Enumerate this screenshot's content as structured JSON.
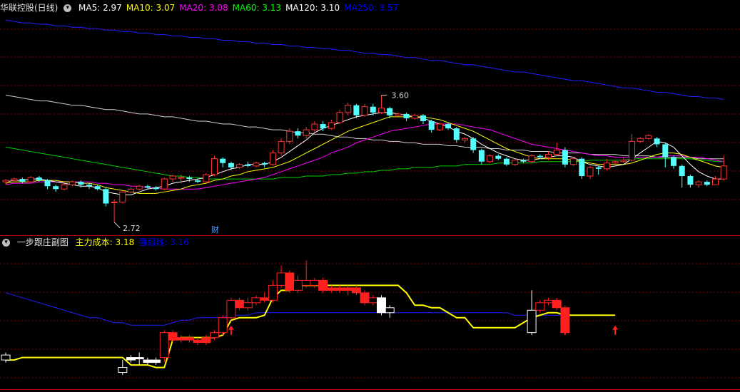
{
  "main_panel": {
    "title": "华联控股(日线)",
    "indicators": [
      {
        "label": "MA5: 2.97",
        "color": "#ffffff"
      },
      {
        "label": "MA10: 3.07",
        "color": "#ffff00"
      },
      {
        "label": "MA20: 3.08",
        "color": "#ff00ff"
      },
      {
        "label": "MA60: 3.13",
        "color": "#00ff00"
      },
      {
        "label": "MA120: 3.10",
        "color": "#ffffff"
      },
      {
        "label": "MA250: 3.57",
        "color": "#0000ff"
      }
    ],
    "high_label": "3.60",
    "low_label": "2.72",
    "marker": "财"
  },
  "sub_panel": {
    "title": "一步跟庄副图",
    "indicators": [
      {
        "label": "主力成本: 3.18",
        "color": "#ffff00"
      },
      {
        "label": "强弱线: 3.16",
        "color": "#0000ff"
      }
    ]
  },
  "colors": {
    "up": "#ff3232",
    "down": "#54ffff",
    "grid": "#8a0000",
    "ma5": "#ffffff",
    "ma10": "#ffff00",
    "ma20": "#ff00ff",
    "ma60": "#00d000",
    "ma120": "#cfcfcf",
    "ma250": "#2020ff",
    "cost": "#ffff00",
    "strength": "#2020ff"
  },
  "candles": [
    [
      3.0,
      3.01,
      2.98,
      3.02
    ],
    [
      3.01,
      3.02,
      3.0,
      3.03
    ],
    [
      3.02,
      3.0,
      2.99,
      3.03
    ],
    [
      3.0,
      3.03,
      2.99,
      3.04
    ],
    [
      3.03,
      3.01,
      3.0,
      3.04
    ],
    [
      3.01,
      2.97,
      2.95,
      3.02
    ],
    [
      2.97,
      2.95,
      2.93,
      2.98
    ],
    [
      2.95,
      2.98,
      2.94,
      2.99
    ],
    [
      2.98,
      3.0,
      2.97,
      3.01
    ],
    [
      3.0,
      2.98,
      2.96,
      3.01
    ],
    [
      2.98,
      2.97,
      2.95,
      2.99
    ],
    [
      2.97,
      2.95,
      2.94,
      2.98
    ],
    [
      2.95,
      2.85,
      2.83,
      2.96
    ],
    [
      2.86,
      2.86,
      2.72,
      2.88
    ],
    [
      2.86,
      2.93,
      2.85,
      2.94
    ],
    [
      2.93,
      2.95,
      2.92,
      2.96
    ],
    [
      2.95,
      2.97,
      2.94,
      2.98
    ],
    [
      2.97,
      2.96,
      2.95,
      2.98
    ],
    [
      2.96,
      2.95,
      2.94,
      2.97
    ],
    [
      2.95,
      3.02,
      2.94,
      3.03
    ],
    [
      3.02,
      3.04,
      3.0,
      3.05
    ],
    [
      3.03,
      3.03,
      2.99,
      3.05
    ],
    [
      3.03,
      3.02,
      3.0,
      3.04
    ],
    [
      3.01,
      3.0,
      2.99,
      3.02
    ],
    [
      3.0,
      3.05,
      2.99,
      3.06
    ],
    [
      3.05,
      3.16,
      3.04,
      3.18
    ],
    [
      3.16,
      3.13,
      3.1,
      3.17
    ],
    [
      3.13,
      3.1,
      3.08,
      3.14
    ],
    [
      3.1,
      3.12,
      3.09,
      3.13
    ],
    [
      3.12,
      3.11,
      3.1,
      3.14
    ],
    [
      3.11,
      3.13,
      3.1,
      3.14
    ],
    [
      3.13,
      3.12,
      3.1,
      3.14
    ],
    [
      3.12,
      3.2,
      3.11,
      3.22
    ],
    [
      3.2,
      3.28,
      3.18,
      3.3
    ],
    [
      3.28,
      3.35,
      3.26,
      3.37
    ],
    [
      3.35,
      3.32,
      3.3,
      3.37
    ],
    [
      3.32,
      3.36,
      3.3,
      3.38
    ],
    [
      3.36,
      3.4,
      3.34,
      3.42
    ],
    [
      3.4,
      3.37,
      3.35,
      3.42
    ],
    [
      3.37,
      3.41,
      3.36,
      3.43
    ],
    [
      3.41,
      3.48,
      3.4,
      3.5
    ],
    [
      3.48,
      3.53,
      3.46,
      3.55
    ],
    [
      3.53,
      3.46,
      3.44,
      3.54
    ],
    [
      3.46,
      3.52,
      3.45,
      3.54
    ],
    [
      3.52,
      3.48,
      3.46,
      3.54
    ],
    [
      3.48,
      3.51,
      3.47,
      3.6
    ],
    [
      3.51,
      3.46,
      3.44,
      3.52
    ],
    [
      3.46,
      3.47,
      3.45,
      3.48
    ],
    [
      3.47,
      3.44,
      3.42,
      3.48
    ],
    [
      3.44,
      3.46,
      3.43,
      3.47
    ],
    [
      3.46,
      3.42,
      3.4,
      3.47
    ],
    [
      3.42,
      3.36,
      3.34,
      3.43
    ],
    [
      3.36,
      3.4,
      3.35,
      3.41
    ],
    [
      3.4,
      3.37,
      3.36,
      3.41
    ],
    [
      3.37,
      3.29,
      3.27,
      3.38
    ],
    [
      3.29,
      3.3,
      3.27,
      3.31
    ],
    [
      3.3,
      3.22,
      3.2,
      3.31
    ],
    [
      3.22,
      3.14,
      3.12,
      3.23
    ],
    [
      3.14,
      3.18,
      3.13,
      3.19
    ],
    [
      3.18,
      3.16,
      3.15,
      3.19
    ],
    [
      3.16,
      3.12,
      3.11,
      3.17
    ],
    [
      3.12,
      3.15,
      3.11,
      3.16
    ],
    [
      3.15,
      3.14,
      3.13,
      3.16
    ],
    [
      3.14,
      3.18,
      3.13,
      3.19
    ],
    [
      3.18,
      3.17,
      3.16,
      3.19
    ],
    [
      3.17,
      3.19,
      3.15,
      3.21
    ],
    [
      3.19,
      3.22,
      3.18,
      3.27
    ],
    [
      3.22,
      3.12,
      3.1,
      3.24
    ],
    [
      3.12,
      3.16,
      3.11,
      3.17
    ],
    [
      3.16,
      3.04,
      3.02,
      3.17
    ],
    [
      3.04,
      3.1,
      3.02,
      3.11
    ],
    [
      3.1,
      3.09,
      3.05,
      3.11
    ],
    [
      3.09,
      3.13,
      3.08,
      3.16
    ],
    [
      3.13,
      3.14,
      3.12,
      3.15
    ],
    [
      3.14,
      3.15,
      3.13,
      3.17
    ],
    [
      3.15,
      3.28,
      3.14,
      3.33
    ],
    [
      3.28,
      3.3,
      3.27,
      3.31
    ],
    [
      3.3,
      3.32,
      3.29,
      3.33
    ],
    [
      3.3,
      3.26,
      3.24,
      3.31
    ],
    [
      3.26,
      3.17,
      3.1,
      3.27
    ],
    [
      3.17,
      3.11,
      3.09,
      3.18
    ],
    [
      3.11,
      3.04,
      2.96,
      3.12
    ],
    [
      3.04,
      2.98,
      2.96,
      3.05
    ],
    [
      2.98,
      3.0,
      2.96,
      3.01
    ],
    [
      3.0,
      2.98,
      2.97,
      3.01
    ],
    [
      2.98,
      3.02,
      2.98,
      3.04
    ],
    [
      3.02,
      3.11,
      3.01,
      3.18
    ]
  ],
  "ma_lines": {
    "ma5": [
      3.0,
      3.01,
      3.01,
      3.02,
      3.02,
      3.01,
      3.0,
      2.99,
      2.98,
      2.97,
      2.97,
      2.96,
      2.93,
      2.92,
      2.91,
      2.91,
      2.93,
      2.95,
      2.96,
      2.97,
      2.99,
      3.0,
      3.01,
      3.02,
      3.03,
      3.05,
      3.07,
      3.09,
      3.1,
      3.12,
      3.12,
      3.12,
      3.14,
      3.17,
      3.21,
      3.25,
      3.29,
      3.34,
      3.37,
      3.39,
      3.41,
      3.43,
      3.45,
      3.46,
      3.47,
      3.48,
      3.48,
      3.47,
      3.46,
      3.45,
      3.44,
      3.42,
      3.4,
      3.38,
      3.35,
      3.33,
      3.3,
      3.26,
      3.23,
      3.2,
      3.18,
      3.16,
      3.15,
      3.15,
      3.16,
      3.17,
      3.18,
      3.18,
      3.17,
      3.14,
      3.12,
      3.11,
      3.1,
      3.11,
      3.12,
      3.16,
      3.2,
      3.24,
      3.28,
      3.27,
      3.24,
      3.18,
      3.12,
      3.07,
      3.04,
      3.02,
      3.02
    ],
    "ma10": [
      2.99,
      3.0,
      3.0,
      3.0,
      3.01,
      3.01,
      3.01,
      3.0,
      3.0,
      2.99,
      2.99,
      2.98,
      2.96,
      2.95,
      2.94,
      2.93,
      2.92,
      2.92,
      2.92,
      2.93,
      2.94,
      2.95,
      2.97,
      2.98,
      2.99,
      3.01,
      3.02,
      3.04,
      3.05,
      3.07,
      3.08,
      3.09,
      3.1,
      3.12,
      3.14,
      3.17,
      3.2,
      3.23,
      3.26,
      3.29,
      3.32,
      3.35,
      3.37,
      3.39,
      3.41,
      3.43,
      3.45,
      3.45,
      3.45,
      3.45,
      3.45,
      3.44,
      3.43,
      3.41,
      3.39,
      3.37,
      3.35,
      3.32,
      3.29,
      3.26,
      3.23,
      3.21,
      3.19,
      3.17,
      3.16,
      3.16,
      3.16,
      3.16,
      3.15,
      3.14,
      3.13,
      3.12,
      3.12,
      3.12,
      3.12,
      3.13,
      3.15,
      3.17,
      3.19,
      3.2,
      3.2,
      3.19,
      3.17,
      3.15,
      3.13,
      3.11,
      3.1
    ],
    "ma20": [
      2.98,
      2.99,
      2.99,
      2.99,
      3.0,
      3.0,
      3.0,
      3.0,
      3.0,
      3.0,
      3.0,
      2.99,
      2.99,
      2.98,
      2.98,
      2.97,
      2.97,
      2.96,
      2.96,
      2.95,
      2.95,
      2.95,
      2.95,
      2.95,
      2.96,
      2.97,
      2.98,
      2.99,
      3.0,
      3.01,
      3.02,
      3.03,
      3.05,
      3.07,
      3.09,
      3.11,
      3.13,
      3.15,
      3.17,
      3.2,
      3.22,
      3.24,
      3.27,
      3.29,
      3.31,
      3.33,
      3.35,
      3.36,
      3.37,
      3.38,
      3.39,
      3.4,
      3.4,
      3.4,
      3.4,
      3.39,
      3.38,
      3.37,
      3.36,
      3.34,
      3.32,
      3.3,
      3.28,
      3.26,
      3.25,
      3.24,
      3.23,
      3.22,
      3.21,
      3.2,
      3.19,
      3.18,
      3.18,
      3.17,
      3.17,
      3.17,
      3.17,
      3.17,
      3.17,
      3.18,
      3.18,
      3.18,
      3.17,
      3.17,
      3.16,
      3.15,
      3.14
    ],
    "ma60": [
      3.24,
      3.23,
      3.22,
      3.21,
      3.2,
      3.19,
      3.18,
      3.17,
      3.16,
      3.15,
      3.14,
      3.13,
      3.12,
      3.11,
      3.1,
      3.09,
      3.08,
      3.07,
      3.06,
      3.05,
      3.04,
      3.04,
      3.03,
      3.03,
      3.02,
      3.02,
      3.02,
      3.02,
      3.02,
      3.02,
      3.02,
      3.02,
      3.02,
      3.03,
      3.03,
      3.03,
      3.04,
      3.04,
      3.04,
      3.05,
      3.05,
      3.06,
      3.06,
      3.07,
      3.07,
      3.08,
      3.08,
      3.09,
      3.09,
      3.1,
      3.1,
      3.1,
      3.11,
      3.11,
      3.11,
      3.12,
      3.12,
      3.12,
      3.12,
      3.13,
      3.13,
      3.13,
      3.13,
      3.13,
      3.14,
      3.14,
      3.14,
      3.14,
      3.14,
      3.14,
      3.15,
      3.15,
      3.15,
      3.15,
      3.15,
      3.16,
      3.16,
      3.16,
      3.16,
      3.16,
      3.16,
      3.16,
      3.16,
      3.15,
      3.15,
      3.14,
      3.14
    ],
    "ma120": [
      3.6,
      3.59,
      3.58,
      3.57,
      3.56,
      3.56,
      3.55,
      3.54,
      3.53,
      3.53,
      3.52,
      3.51,
      3.5,
      3.5,
      3.49,
      3.48,
      3.47,
      3.47,
      3.46,
      3.45,
      3.45,
      3.44,
      3.43,
      3.42,
      3.42,
      3.41,
      3.4,
      3.4,
      3.39,
      3.38,
      3.38,
      3.37,
      3.36,
      3.36,
      3.35,
      3.34,
      3.34,
      3.33,
      3.33,
      3.32,
      3.31,
      3.31,
      3.3,
      3.3,
      3.29,
      3.29,
      3.28,
      3.28,
      3.27,
      3.27,
      3.26,
      3.26,
      3.26,
      3.25,
      3.25,
      3.24,
      3.24,
      3.24,
      3.23,
      3.23,
      3.22,
      3.22,
      3.22,
      3.21,
      3.21,
      3.21,
      3.2,
      3.2,
      3.2,
      3.2,
      3.19,
      3.19,
      3.19,
      3.19,
      3.18,
      3.18,
      3.18,
      3.18,
      3.17,
      3.17,
      3.17,
      3.17,
      3.17,
      3.16,
      3.16,
      3.16,
      3.16
    ],
    "ma250": [
      4.12,
      4.11,
      4.1,
      4.1,
      4.09,
      4.09,
      4.08,
      4.08,
      4.07,
      4.07,
      4.06,
      4.06,
      4.05,
      4.05,
      4.04,
      4.04,
      4.03,
      4.03,
      4.02,
      4.02,
      4.01,
      4.01,
      4.0,
      4.0,
      3.99,
      3.99,
      3.98,
      3.98,
      3.97,
      3.97,
      3.96,
      3.96,
      3.95,
      3.95,
      3.94,
      3.94,
      3.93,
      3.93,
      3.92,
      3.92,
      3.91,
      3.91,
      3.9,
      3.89,
      3.89,
      3.88,
      3.88,
      3.87,
      3.86,
      3.86,
      3.85,
      3.84,
      3.84,
      3.83,
      3.82,
      3.81,
      3.81,
      3.8,
      3.79,
      3.78,
      3.77,
      3.76,
      3.76,
      3.75,
      3.74,
      3.73,
      3.72,
      3.71,
      3.7,
      3.7,
      3.69,
      3.68,
      3.67,
      3.66,
      3.65,
      3.65,
      3.64,
      3.63,
      3.62,
      3.62,
      3.61,
      3.6,
      3.59,
      3.59,
      3.58,
      3.58,
      3.57
    ]
  },
  "sub_candles": [
    [
      0,
      2.95,
      2.97,
      2.94,
      2.98,
      "hollow"
    ],
    [
      14,
      2.92,
      2.9,
      2.89,
      2.95,
      "hollow"
    ],
    [
      15,
      2.95,
      2.96,
      2.94,
      2.97,
      "white"
    ],
    [
      16,
      2.96,
      2.96,
      2.93,
      2.98,
      "white"
    ],
    [
      17,
      2.95,
      2.94,
      2.93,
      2.96,
      "white"
    ],
    [
      18,
      2.94,
      2.95,
      2.93,
      2.96,
      "white"
    ],
    [
      19,
      2.96,
      3.06,
      2.94,
      3.07,
      "hollow-red"
    ],
    [
      20,
      3.06,
      3.03,
      3.02,
      3.07,
      "red"
    ],
    [
      21,
      3.03,
      3.04,
      3.02,
      3.05,
      "red"
    ],
    [
      22,
      3.04,
      3.03,
      3.02,
      3.05,
      "red"
    ],
    [
      23,
      3.03,
      3.02,
      3.01,
      3.04,
      "red"
    ],
    [
      24,
      3.02,
      3.04,
      3.01,
      3.05,
      "red"
    ],
    [
      25,
      3.04,
      3.06,
      3.03,
      3.07,
      "hollow-red"
    ],
    [
      26,
      3.06,
      3.12,
      3.05,
      3.13,
      "hollow-red"
    ],
    [
      27,
      3.12,
      3.19,
      3.11,
      3.2,
      "hollow-red"
    ],
    [
      28,
      3.19,
      3.16,
      3.15,
      3.2,
      "red"
    ],
    [
      29,
      3.16,
      3.18,
      3.15,
      3.2,
      "hollow-red"
    ],
    [
      30,
      3.18,
      3.2,
      3.17,
      3.21,
      "hollow-red"
    ],
    [
      31,
      3.2,
      3.19,
      3.18,
      3.22,
      "red"
    ],
    [
      32,
      3.19,
      3.25,
      3.18,
      3.27,
      "hollow-red"
    ],
    [
      33,
      3.25,
      3.3,
      3.24,
      3.33,
      "hollow-red"
    ],
    [
      34,
      3.3,
      3.23,
      3.22,
      3.31,
      "red"
    ],
    [
      35,
      3.23,
      3.27,
      3.22,
      3.29,
      "hollow-red"
    ],
    [
      36,
      3.27,
      3.25,
      3.24,
      3.35,
      "hollow-red"
    ],
    [
      37,
      3.25,
      3.27,
      3.24,
      3.28,
      "hollow-red"
    ],
    [
      38,
      3.27,
      3.23,
      3.22,
      3.28,
      "red"
    ],
    [
      39,
      3.23,
      3.24,
      3.22,
      3.25,
      "red"
    ],
    [
      40,
      3.24,
      3.23,
      3.22,
      3.25,
      "red"
    ],
    [
      41,
      3.23,
      3.24,
      3.21,
      3.25,
      "red"
    ],
    [
      42,
      3.24,
      3.22,
      3.21,
      3.25,
      "red"
    ],
    [
      43,
      3.22,
      3.18,
      3.17,
      3.23,
      "red"
    ],
    [
      44,
      3.18,
      3.2,
      3.17,
      3.21,
      "hollow-red"
    ],
    [
      45,
      3.2,
      3.14,
      3.13,
      3.21,
      "white"
    ],
    [
      46,
      3.14,
      3.16,
      3.12,
      3.17,
      "hollow"
    ],
    [
      63,
      3.06,
      3.15,
      3.05,
      3.23,
      "hollow"
    ],
    [
      64,
      3.15,
      3.18,
      3.14,
      3.19,
      "hollow-red"
    ],
    [
      65,
      3.18,
      3.19,
      3.17,
      3.2,
      "hollow-red"
    ],
    [
      66,
      3.19,
      3.16,
      3.15,
      3.2,
      "red"
    ],
    [
      67,
      3.16,
      3.06,
      3.05,
      3.17,
      "red"
    ]
  ],
  "cost_line": [
    [
      0,
      2.95
    ],
    [
      1,
      2.95
    ],
    [
      2,
      2.96
    ],
    [
      3,
      2.96
    ],
    [
      4,
      2.96
    ],
    [
      5,
      2.96
    ],
    [
      6,
      2.96
    ],
    [
      7,
      2.96
    ],
    [
      8,
      2.96
    ],
    [
      9,
      2.96
    ],
    [
      10,
      2.96
    ],
    [
      11,
      2.96
    ],
    [
      12,
      2.96
    ],
    [
      13,
      2.96
    ],
    [
      14,
      2.96
    ],
    [
      15,
      2.93
    ],
    [
      16,
      2.93
    ],
    [
      17,
      2.93
    ],
    [
      18,
      2.92
    ],
    [
      19,
      2.92
    ],
    [
      20,
      3.03
    ],
    [
      21,
      3.04
    ],
    [
      22,
      3.04
    ],
    [
      23,
      3.04
    ],
    [
      24,
      3.04
    ],
    [
      25,
      3.04
    ],
    [
      26,
      3.05
    ],
    [
      27,
      3.11
    ],
    [
      28,
      3.12
    ],
    [
      29,
      3.12
    ],
    [
      30,
      3.12
    ],
    [
      31,
      3.13
    ],
    [
      32,
      3.2
    ],
    [
      33,
      3.23
    ],
    [
      34,
      3.23
    ],
    [
      35,
      3.25
    ],
    [
      36,
      3.25
    ],
    [
      37,
      3.25
    ],
    [
      38,
      3.25
    ],
    [
      39,
      3.25
    ],
    [
      40,
      3.25
    ],
    [
      41,
      3.25
    ],
    [
      42,
      3.25
    ],
    [
      43,
      3.25
    ],
    [
      44,
      3.25
    ],
    [
      45,
      3.25
    ],
    [
      46,
      3.25
    ],
    [
      47,
      3.25
    ],
    [
      48,
      3.22
    ],
    [
      49,
      3.17
    ],
    [
      50,
      3.17
    ],
    [
      51,
      3.16
    ],
    [
      52,
      3.16
    ],
    [
      53,
      3.14
    ],
    [
      54,
      3.12
    ],
    [
      55,
      3.12
    ],
    [
      56,
      3.08
    ],
    [
      57,
      3.08
    ],
    [
      58,
      3.08
    ],
    [
      59,
      3.08
    ],
    [
      60,
      3.08
    ],
    [
      61,
      3.08
    ],
    [
      62,
      3.1
    ],
    [
      63,
      3.12
    ],
    [
      64,
      3.13
    ],
    [
      65,
      3.14
    ],
    [
      66,
      3.14
    ],
    [
      67,
      3.13
    ],
    [
      68,
      3.13
    ],
    [
      69,
      3.13
    ],
    [
      70,
      3.13
    ],
    [
      71,
      3.13
    ],
    [
      72,
      3.13
    ],
    [
      73,
      3.13
    ]
  ],
  "strength_line": [
    3.22,
    3.21,
    3.2,
    3.19,
    3.18,
    3.17,
    3.16,
    3.15,
    3.14,
    3.13,
    3.12,
    3.12,
    3.11,
    3.1,
    3.1,
    3.09,
    3.09,
    3.09,
    3.09,
    3.09,
    3.1,
    3.11,
    3.11,
    3.12,
    3.12,
    3.12,
    3.12,
    3.13,
    3.13,
    3.13,
    3.14,
    3.14,
    3.14,
    3.14,
    3.14,
    3.14,
    3.14,
    3.14,
    3.14,
    3.14,
    3.14,
    3.14,
    3.14,
    3.14,
    3.14,
    3.14,
    3.14,
    3.14,
    3.14,
    3.14,
    3.14,
    3.14,
    3.14,
    3.14,
    3.14,
    3.14,
    3.14,
    3.14,
    3.14,
    3.14,
    3.14,
    3.13,
    3.13,
    3.13,
    3.13,
    3.13,
    3.13,
    3.13,
    3.13,
    3.13,
    3.13,
    3.13,
    3.13,
    3.13
  ],
  "arrows": [
    27,
    67,
    73
  ]
}
